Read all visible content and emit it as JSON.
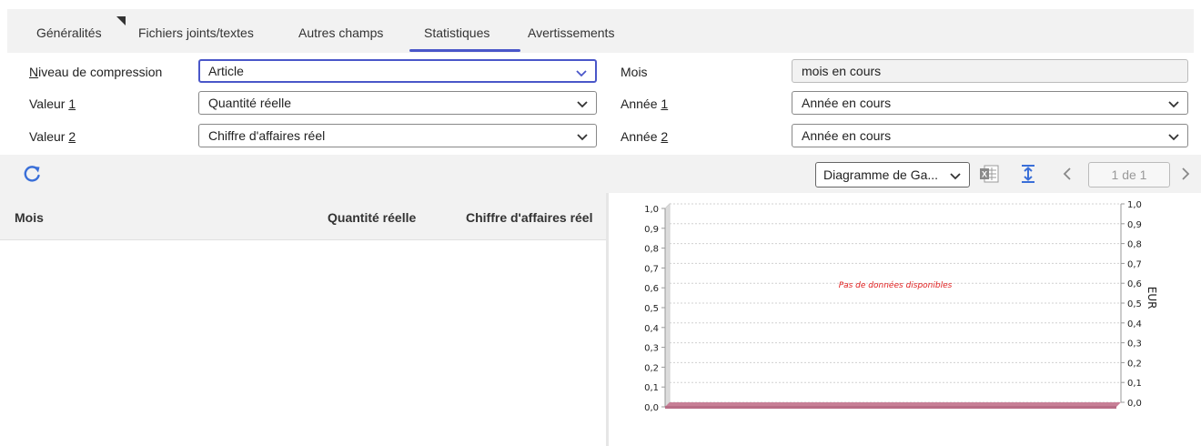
{
  "tabs": [
    {
      "label": "Généralités"
    },
    {
      "label": "Fichiers joints/textes"
    },
    {
      "label": "Autres champs"
    },
    {
      "label": "Statistiques",
      "active": true
    },
    {
      "label": "Avertissements"
    }
  ],
  "form": {
    "compression": {
      "label_key": "N",
      "label_rest": "iveau de compression",
      "value": "Article"
    },
    "valeur1": {
      "label_pre": "Valeur ",
      "label_key": "1",
      "value": "Quantité réelle"
    },
    "valeur2": {
      "label_pre": "Valeur ",
      "label_key": "2",
      "value": "Chiffre d'affaires réel"
    },
    "mois": {
      "label": "Mois",
      "value": "mois en cours"
    },
    "annee1": {
      "label_pre": "Année ",
      "label_key": "1",
      "value": "Année en cours"
    },
    "annee2": {
      "label_pre": "Année ",
      "label_key": "2",
      "value": "Année en cours"
    }
  },
  "toolbar": {
    "chart_type": "Diagramme de Ga...",
    "page": "1 de 1"
  },
  "table": {
    "columns": [
      "Mois",
      "Quantité réelle",
      "Chiffre d'affaires réel"
    ]
  },
  "colors": {
    "accent": "#4a57c9",
    "bar_floor": "#c77f96",
    "no_data_text": "#e02020"
  },
  "chart_data": {
    "type": "bar",
    "categories": [],
    "series": [],
    "no_data_message": "Pas de données disponibles",
    "ylim": [
      0.0,
      1.0
    ],
    "y_ticks": [
      "1,0",
      "0,9",
      "0,8",
      "0,7",
      "0,6",
      "0,5",
      "0,4",
      "0,3",
      "0,2",
      "0,1",
      "0,0"
    ],
    "y2_ticks": [
      "1,0",
      "0,9",
      "0,8",
      "0,7",
      "0,6",
      "0,5",
      "0,4",
      "0,3",
      "0,2",
      "0,1",
      "0,0"
    ],
    "y2label": "EUR",
    "grid": true
  }
}
